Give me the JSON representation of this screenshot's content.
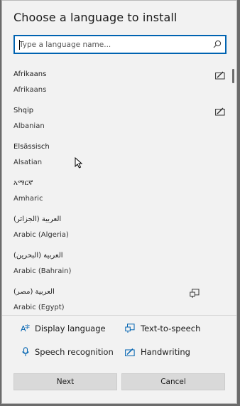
{
  "dialog": {
    "title": "Choose a language to install",
    "search": {
      "placeholder": "Type a language name...",
      "value": ""
    }
  },
  "languages": [
    {
      "native": "Afrikaans",
      "english": "Afrikaans",
      "feature_icon": "handwriting-icon"
    },
    {
      "native": "Shqip",
      "english": "Albanian",
      "feature_icon": "handwriting-icon"
    },
    {
      "native": "Elsässisch",
      "english": "Alsatian",
      "feature_icon": ""
    },
    {
      "native": "አማርኛ",
      "english": "Amharic",
      "feature_icon": ""
    },
    {
      "native": "العربية (الجزائر)",
      "english": "Arabic (Algeria)",
      "feature_icon": ""
    },
    {
      "native": "العربية (البحرين)",
      "english": "Arabic (Bahrain)",
      "feature_icon": ""
    },
    {
      "native": "العربية (مصر)",
      "english": "Arabic (Egypt)",
      "feature_icon": "text-to-speech-icon"
    }
  ],
  "legend": {
    "display_language": "Display language",
    "text_to_speech": "Text-to-speech",
    "speech_recognition": "Speech recognition",
    "handwriting": "Handwriting"
  },
  "buttons": {
    "next": "Next",
    "cancel": "Cancel"
  },
  "colors": {
    "accent": "#0063b1",
    "background": "#f2f2f2",
    "button": "#d9d9d9"
  }
}
